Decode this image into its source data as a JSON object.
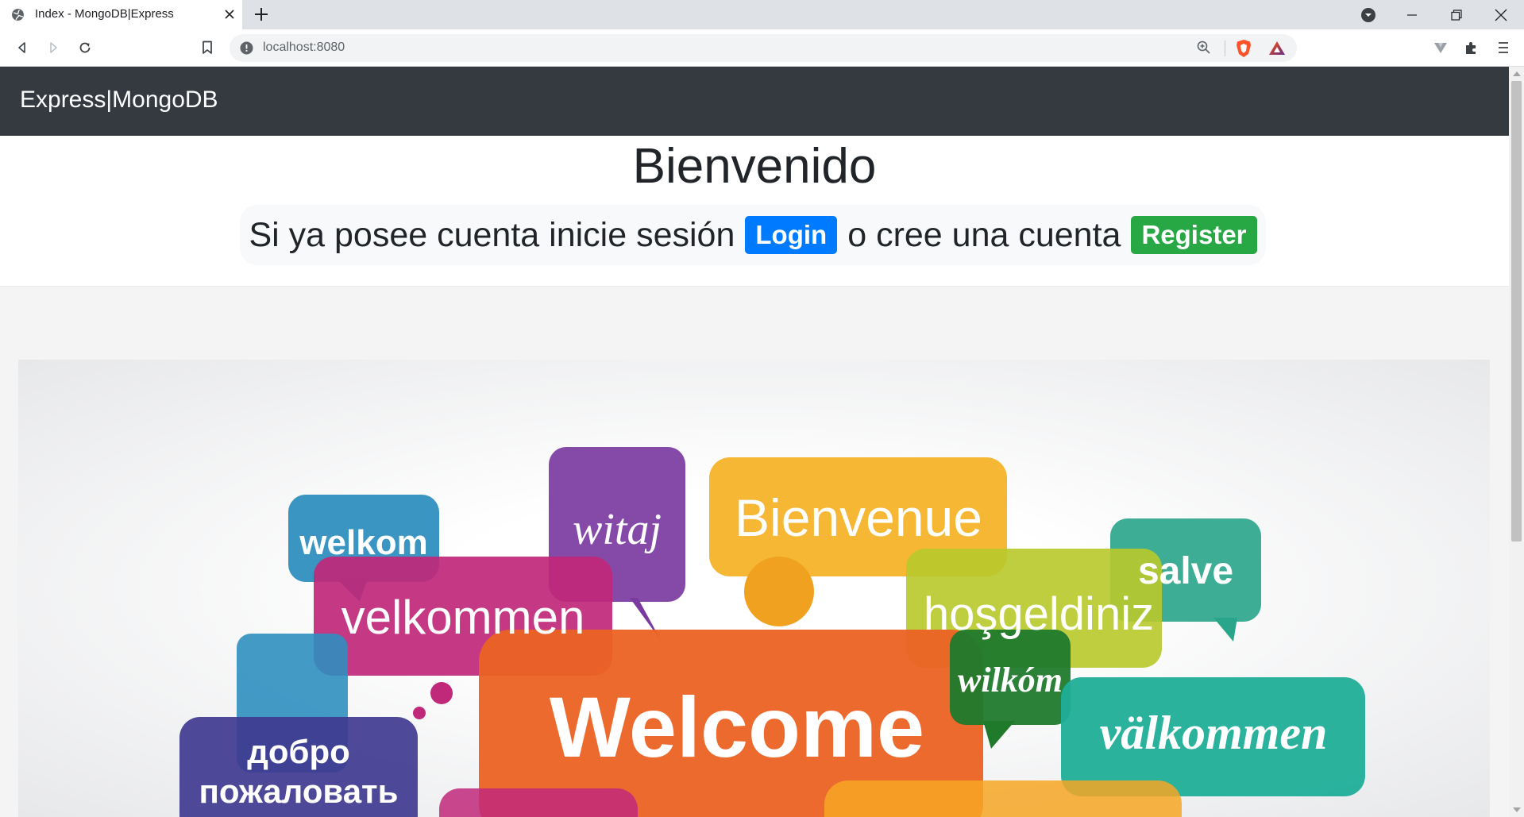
{
  "browser": {
    "tab_title": "Index - MongoDB|Express",
    "url": "localhost:8080"
  },
  "navbar": {
    "brand": "Express|MongoDB"
  },
  "hero": {
    "title": "Bienvenido",
    "text_before_login": "Si ya posee cuenta inicie sesión",
    "login_label": "Login",
    "text_between": "o cree una cuenta",
    "register_label": "Register"
  },
  "welcome_image": {
    "words": [
      "welkom",
      "witaj",
      "Bienvenue",
      "salve",
      "velkommen",
      "hoşgeldiniz",
      "wilkóm",
      "Welcome",
      "välkommen",
      "добро",
      "пожаловать"
    ]
  },
  "colors": {
    "navbar": "#343a40",
    "login": "#007bff",
    "register": "#28a745"
  },
  "icons": [
    "globe-icon",
    "close-icon",
    "plus-icon",
    "back-icon",
    "forward-icon",
    "reload-icon",
    "bookmark-icon",
    "info-icon",
    "zoom-icon",
    "brave-shield-icon",
    "brave-rewards-icon",
    "extensions-icon",
    "menu-icon"
  ]
}
